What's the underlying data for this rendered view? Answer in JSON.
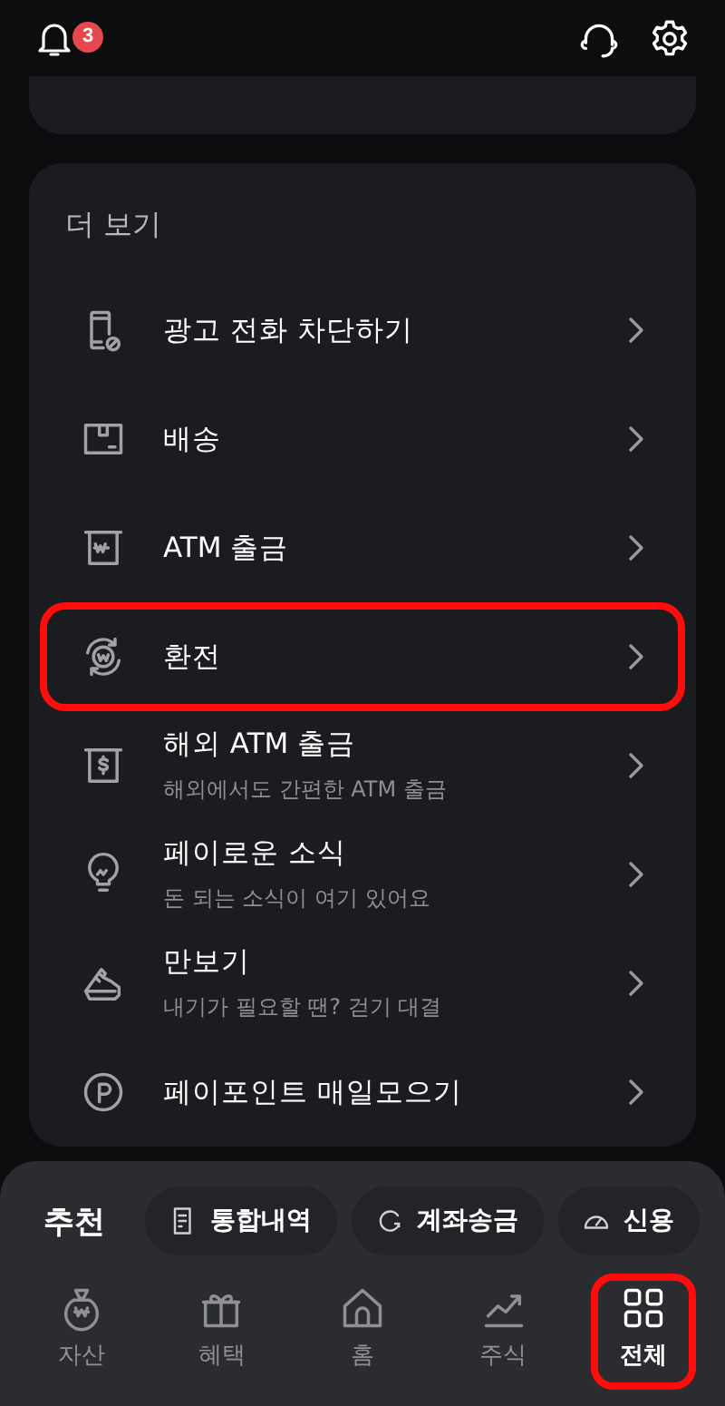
{
  "top_bar": {
    "notification_count": "3"
  },
  "more_section": {
    "title": "더 보기",
    "items": [
      {
        "title": "광고 전화 차단하기",
        "highlighted": false
      },
      {
        "title": "배송",
        "highlighted": false
      },
      {
        "title": "ATM 출금",
        "highlighted": false
      },
      {
        "title": "환전",
        "highlighted": true
      },
      {
        "title": "해외 ATM 출금",
        "subtitle": "해외에서도 간편한 ATM 출금",
        "highlighted": false
      },
      {
        "title": "페이로운 소식",
        "subtitle": "돈 되는 소식이 여기 있어요",
        "highlighted": false
      },
      {
        "title": "만보기",
        "subtitle": "내기가 필요할 땐? 걷기 대결",
        "highlighted": false
      },
      {
        "title": "페이포인트 매일모으기",
        "highlighted": false
      }
    ]
  },
  "recommend": {
    "label": "추천",
    "chips": [
      {
        "label": "통합내역"
      },
      {
        "label": "계좌송금"
      },
      {
        "label": "신용"
      }
    ]
  },
  "bottom_nav": [
    {
      "label": "자산",
      "selected": false,
      "highlighted": false
    },
    {
      "label": "혜택",
      "selected": false,
      "highlighted": false
    },
    {
      "label": "홈",
      "selected": false,
      "highlighted": false
    },
    {
      "label": "주식",
      "selected": false,
      "highlighted": false
    },
    {
      "label": "전체",
      "selected": true,
      "highlighted": true
    }
  ]
}
